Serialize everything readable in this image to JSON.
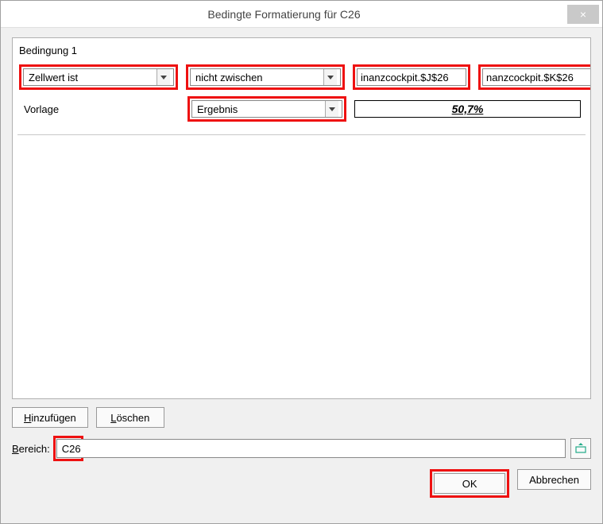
{
  "dialog": {
    "title": "Bedingte Formatierung für C26",
    "close": "×"
  },
  "condition": {
    "heading": "Bedingung 1",
    "type": "Zellwert ist",
    "operator": "nicht zwischen",
    "ref1": "inanzcockpit.$J$26",
    "ref2": "nanzcockpit.$K$26",
    "template_label": "Vorlage",
    "template_value": "Ergebnis",
    "preview_value": "50,7%"
  },
  "buttons": {
    "add_u": "H",
    "add_rest": "inzufügen",
    "del_u": "L",
    "del_rest": "öschen",
    "range_u": "B",
    "range_rest": "ereich:",
    "ok": "OK",
    "cancel": "Abbrechen"
  },
  "range": {
    "value": "C26"
  }
}
